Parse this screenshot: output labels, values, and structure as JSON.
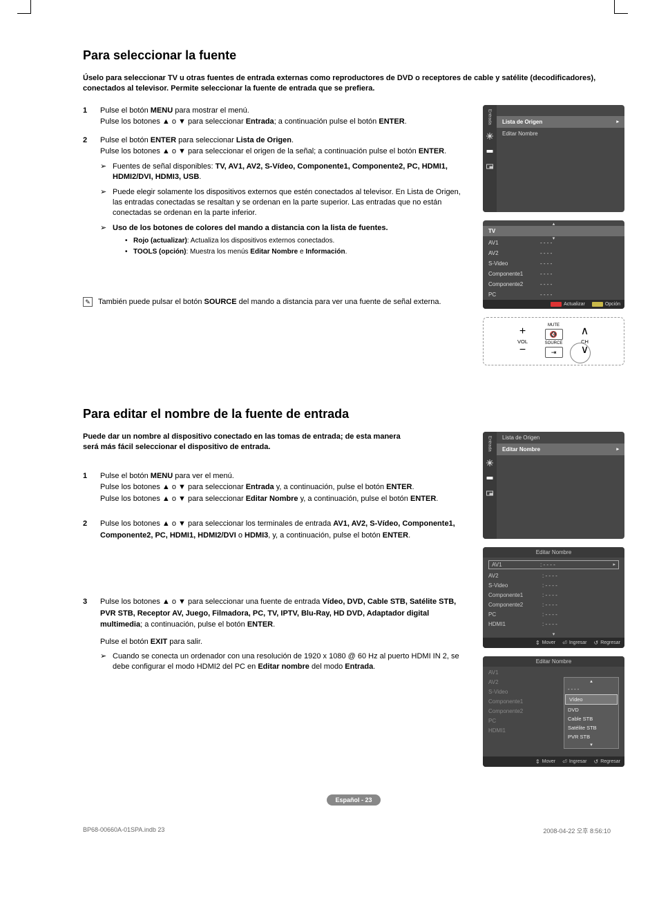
{
  "sec1": {
    "heading": "Para seleccionar la fuente",
    "intro": "Úselo para seleccionar TV u otras fuentes de entrada externas como reproductores de DVD o receptores de cable y satélite (decodificadores), conectados al televisor. Permite seleccionar la fuente de entrada que se prefiera.",
    "step1a": "Pulse el botón ",
    "step1a_b": "MENU",
    "step1a2": " para mostrar el menú.",
    "step1b": "Pulse los botones ▲ o ▼ para seleccionar ",
    "step1b_b": "Entrada",
    "step1b2": "; a continuación pulse el botón ",
    "step1b_b2": "ENTER",
    "step1b3": ".",
    "step2a": "Pulse el botón ",
    "step2a_b": "ENTER",
    "step2a2": " para seleccionar ",
    "step2a_b2": "Lista de Origen",
    "step2a3": ".",
    "step2b": "Pulse los botones ▲ o ▼ para seleccionar el origen de la señal; a continuación pulse el botón ",
    "step2b_b": "ENTER",
    "step2b2": ".",
    "arrow1": "Fuentes de señal disponibles: ",
    "arrow1_items": "TV, AV1, AV2, S-Vídeo, Componente1, Componente2, PC, HDMI1, HDMI2/DVI, HDMI3, USB",
    "arrow1_end": ".",
    "arrow2": "Puede elegir solamente los dispositivos externos que estén conectados al televisor. En Lista de Origen, las entradas conectadas se resaltan y se ordenan en la parte superior. Las entradas que no están conectadas se ordenan en la parte inferior.",
    "arrow3": "Uso de los botones de colores del mando a distancia con la lista de fuentes.",
    "bullet1_b": "Rojo (actualizar)",
    "bullet1": ": Actualiza los dispositivos externos conectados.",
    "bullet2_b": "TOOLS (opción)",
    "bullet2": ": Muestra los menús ",
    "bullet2_b2": "Editar Nombre",
    "bullet2_mid": " e ",
    "bullet2_b3": "Información",
    "bullet2_end": ".",
    "tip1": "También puede pulsar el botón ",
    "tip1_b": "SOURCE",
    "tip1_end": " del mando a distancia para ver una fuente de señal externa."
  },
  "osd1": {
    "sidelabel": "Entrada",
    "r1": "Lista de Origen",
    "r2": "Editar Nombre"
  },
  "osd2": {
    "header": "TV",
    "rows": [
      "AV1",
      "AV2",
      "S-Video",
      "Componente1",
      "Componente2",
      "PC"
    ],
    "dash": "- - - -",
    "act": "Actualizar",
    "opt": "Opción"
  },
  "remote": {
    "vol": "VOL",
    "mute": "MUTE",
    "source": "SOURCE",
    "ch": "CH"
  },
  "sec2": {
    "heading": "Para editar el nombre de la fuente de entrada",
    "intro": "Puede dar un nombre al dispositivo conectado en las tomas de entrada; de esta manera será más fácil seleccionar el dispositivo de entrada.",
    "step1a": "Pulse el botón ",
    "step1a_b": "MENU",
    "step1a2": " para ver el menú.",
    "step1b": "Pulse los botones ▲ o ▼ para seleccionar ",
    "step1b_b": "Entrada",
    "step1b2": " y, a continuación, pulse el botón ",
    "step1b_b2": "ENTER",
    "step1b3": ".",
    "step1c": "Pulse los botones ▲ o ▼ para seleccionar ",
    "step1c_b": "Editar Nombre",
    "step1c2": " y, a continuación, pulse el botón ",
    "step1c_b2": "ENTER",
    "step1c3": ".",
    "step2a": "Pulse los botones ▲ o ▼ para seleccionar los terminales de entrada ",
    "step2a_items": "AV1, AV2, S-Vídeo, Componente1, Componente2, PC, HDMI1, HDMI2/DVI",
    "step2a_or": " o ",
    "step2a_last": "HDMI3",
    "step2a2": ", y, a continuación, pulse el botón ",
    "step2a_b2": "ENTER",
    "step2a3": ".",
    "step3a": "Pulse los botones ▲ o ▼ para seleccionar una fuente de entrada ",
    "step3a_items": "Vídeo, DVD, Cable STB, Satélite STB, PVR STB, Receptor AV, Juego, Filmadora, PC, TV, IPTV, Blu-Ray, HD DVD, Adaptador digital multimedia",
    "step3a2": "; a continuación, pulse el botón ",
    "step3a_b2": "ENTER",
    "step3a3": ".",
    "step3b": "Pulse el botón ",
    "step3b_b": "EXIT",
    "step3b2": " para salir.",
    "step3arrow": "Cuando se conecta un ordenador con una resolución de 1920 x 1080 @ 60 Hz al puerto HDMI IN 2, se debe configurar el modo HDMI2 del PC en ",
    "step3arrow_b": "Editar nombre",
    "step3arrow2": " del modo ",
    "step3arrow_b2": "Entrada",
    "step3arrow3": "."
  },
  "osd3": {
    "sidelabel": "Entrada",
    "r1": "Lista de Origen",
    "r2": "Editar Nombre"
  },
  "osd4": {
    "title": "Editar Nombre",
    "rows": [
      "AV1",
      "AV2",
      "S-Video",
      "Componente1",
      "Componente2",
      "PC",
      "HDMI1"
    ],
    "dash": ": - - - -",
    "mover": "Mover",
    "ingresar": "Ingresar",
    "regresar": "Regresar"
  },
  "osd5": {
    "title": "Editar Nombre",
    "rows": [
      "AV1",
      "AV2",
      "S-Video",
      "Componente1",
      "Componente2",
      "PC",
      "HDMI1"
    ],
    "popup": [
      "- - - -",
      "Vídeo",
      "DVD",
      "Cable STB",
      "Satélite STB",
      "PVR STB"
    ],
    "mover": "Mover",
    "ingresar": "Ingresar",
    "regresar": "Regresar"
  },
  "footer": {
    "badge": "Español - 23",
    "docfile": "BP68-00660A-01SPA.indb   23",
    "docdate": "2008-04-22   오후 8:56:10"
  }
}
